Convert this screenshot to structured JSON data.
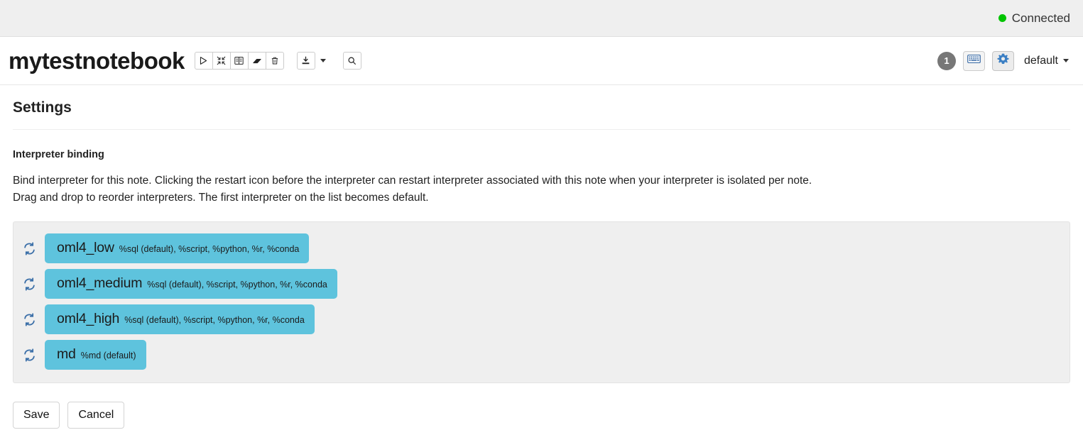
{
  "topbar": {
    "connection_status": "Connected",
    "connection_color": "#00c400"
  },
  "note_header": {
    "title": "mytestnotebook",
    "toolbar": [
      {
        "name": "run-all-paragraphs",
        "icon": "play-icon",
        "label": "Run all paragraphs"
      },
      {
        "name": "collapse-all",
        "icon": "collapse-arrows-icon",
        "label": "Show/hide all output"
      },
      {
        "name": "show-hide-code",
        "icon": "book-icon",
        "label": "Show/hide the code"
      },
      {
        "name": "clear-output",
        "icon": "eraser-icon",
        "label": "Clear output"
      },
      {
        "name": "delete-note",
        "icon": "trash-icon",
        "label": "Remove the notebook"
      }
    ],
    "export_label": "Export",
    "export_icon": "download-icon",
    "search_icon": "search-icon",
    "version_badge": "1",
    "keyboard_icon": "keyboard-icon",
    "settings_icon": "gear-icon",
    "permissions_label": "default"
  },
  "settings": {
    "heading": "Settings",
    "section_label": "Interpreter binding",
    "description_line1": "Bind interpreter for this note. Clicking the restart icon before the interpreter can restart interpreter associated with this note when your interpreter is isolated per note.",
    "description_line2": "Drag and drop to reorder interpreters. The first interpreter on the list becomes default.",
    "chip_color": "#5ec3dd",
    "panel_color": "#efefef",
    "interpreters": [
      {
        "name": "oml4_low",
        "magics": "%sql (default), %script, %python, %r, %conda",
        "restart_icon": "restart-icon"
      },
      {
        "name": "oml4_medium",
        "magics": "%sql (default), %script, %python, %r, %conda",
        "restart_icon": "restart-icon"
      },
      {
        "name": "oml4_high",
        "magics": "%sql (default), %script, %python, %r, %conda",
        "restart_icon": "restart-icon"
      },
      {
        "name": "md",
        "magics": "%md (default)",
        "restart_icon": "restart-icon"
      }
    ],
    "save_label": "Save",
    "cancel_label": "Cancel"
  }
}
